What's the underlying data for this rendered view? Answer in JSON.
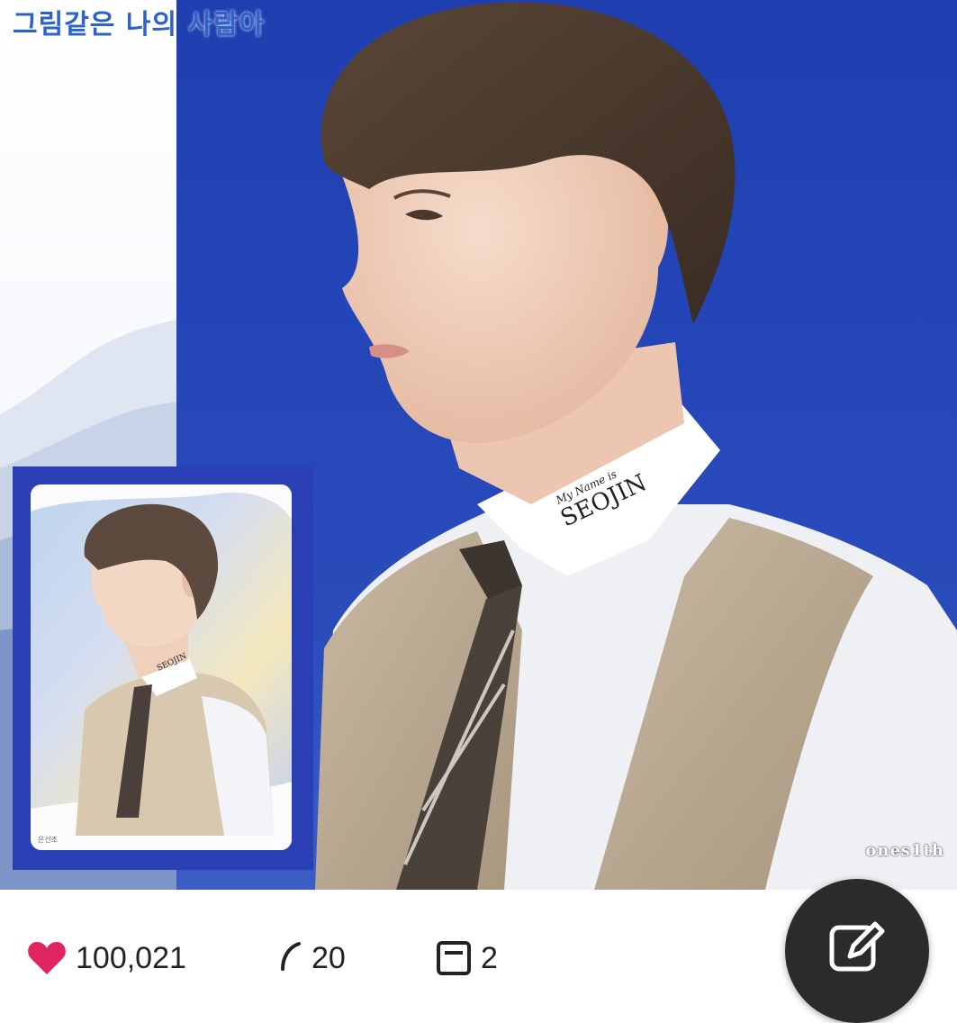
{
  "post": {
    "caption_overlay": "그림같은 나의 사람아",
    "nametag": {
      "small": "My Name is",
      "name": "SEOJIN"
    },
    "watermark": "ones1th",
    "card_signature": "은선조"
  },
  "actions": {
    "likes": "100,021",
    "comments": "20",
    "saves": "2",
    "edit_icon": "edit-icon"
  },
  "colors": {
    "background_blue": "#2446b8",
    "card_frame": "#2b3fb4",
    "caption": "#2d63c9",
    "like_heart": "#e0245e",
    "fab": "#2b2b2b"
  }
}
